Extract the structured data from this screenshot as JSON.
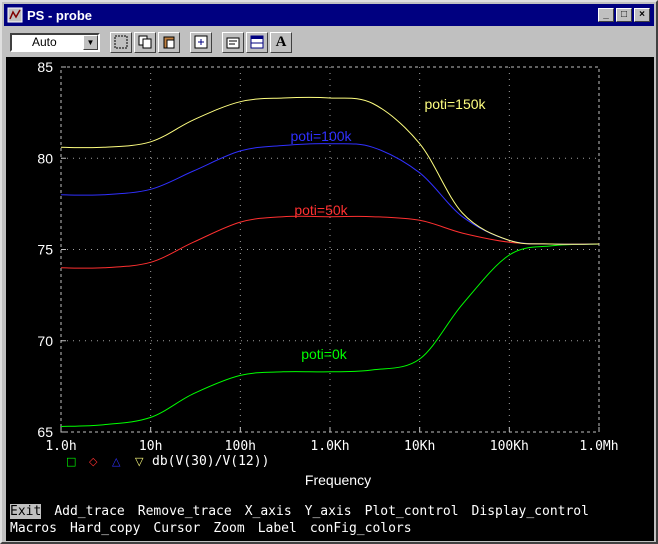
{
  "window": {
    "title": "PS - probe"
  },
  "toolbar": {
    "zoom_value": "Auto"
  },
  "chart_data": {
    "type": "line",
    "xscale": "log",
    "xlim": [
      1,
      1000000
    ],
    "ylim": [
      65,
      85
    ],
    "grid": true,
    "xlabel": "Frequency",
    "ylabel": "",
    "y_ticks": [
      "85",
      "80",
      "75",
      "70",
      "65"
    ],
    "x_ticks": [
      "1.0h",
      "10h",
      "100h",
      "1.0Kh",
      "10Kh",
      "100Kh",
      "1.0Mh"
    ],
    "expression": "db(V(30)/V(12))",
    "legend_markers": [
      "□",
      "◇",
      "△",
      "▽"
    ],
    "series": [
      {
        "name": "poti=0k",
        "color": "#00ff00",
        "marker": "□",
        "x": [
          1,
          3,
          10,
          30,
          100,
          300,
          1000,
          3000,
          10000,
          30000,
          100000,
          300000,
          1000000
        ],
        "y": [
          65.3,
          65.4,
          65.8,
          67.1,
          68.1,
          68.3,
          68.3,
          68.4,
          69.0,
          72.0,
          74.7,
          75.2,
          75.3
        ]
      },
      {
        "name": "poti=50k",
        "color": "#ff3030",
        "marker": "◇",
        "x": [
          1,
          3,
          10,
          30,
          100,
          300,
          1000,
          3000,
          10000,
          30000,
          100000,
          300000,
          1000000
        ],
        "y": [
          74.0,
          74.0,
          74.3,
          75.4,
          76.5,
          76.8,
          76.8,
          76.8,
          76.6,
          75.9,
          75.4,
          75.3,
          75.3
        ]
      },
      {
        "name": "poti=100k",
        "color": "#3030ff",
        "marker": "△",
        "x": [
          1,
          3,
          10,
          30,
          100,
          300,
          1000,
          3000,
          10000,
          30000,
          100000,
          300000,
          1000000
        ],
        "y": [
          78.0,
          78.0,
          78.3,
          79.3,
          80.4,
          80.7,
          80.8,
          80.6,
          79.2,
          76.8,
          75.5,
          75.3,
          75.3
        ]
      },
      {
        "name": "poti=150k",
        "color": "#ffff80",
        "marker": "▽",
        "x": [
          1,
          3,
          10,
          30,
          100,
          300,
          1000,
          3000,
          10000,
          30000,
          100000,
          300000,
          1000000
        ],
        "y": [
          80.6,
          80.6,
          80.9,
          82.1,
          83.1,
          83.3,
          83.3,
          83.0,
          80.8,
          77.0,
          75.5,
          75.3,
          75.3
        ]
      }
    ]
  },
  "menu": {
    "row1": [
      "Exit",
      "Add_trace",
      "Remove_trace",
      "X_axis",
      "Y_axis",
      "Plot_control",
      "Display_control"
    ],
    "row2": [
      "Macros",
      "Hard_copy",
      "Cursor",
      "Zoom",
      "Label",
      "conFig_colors"
    ]
  }
}
